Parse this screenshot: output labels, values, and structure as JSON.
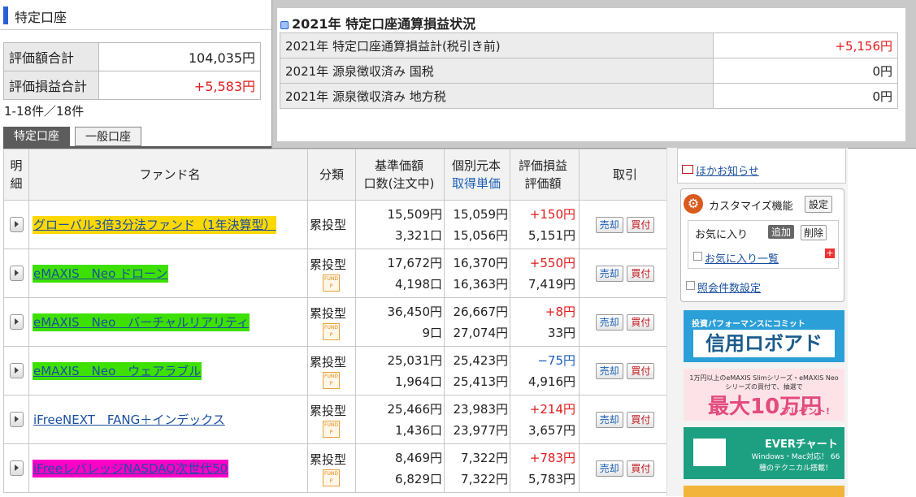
{
  "header": {
    "title": "特定口座"
  },
  "summary": [
    {
      "label": "評価額合計",
      "value": "104,035円",
      "color": "#222222"
    },
    {
      "label": "評価損益合計",
      "value": "+5,583円",
      "color": "#e01b1b"
    }
  ],
  "count_text": "1-18件／18件",
  "tabs": {
    "tokutei": "特定口座",
    "ippan": "一般口座"
  },
  "columns": {
    "detail": [
      "明",
      "細"
    ],
    "fund_name": "ファンド名",
    "category": "分類",
    "price": [
      "基準価額",
      "口数(注文中)"
    ],
    "cost": [
      "個別元本",
      "取得単価"
    ],
    "pl": [
      "評価損益",
      "評価額"
    ],
    "trade": "取引"
  },
  "funds": [
    {
      "name": "グローバル3倍3分法ファンド（1年決算型）",
      "highlight": "yellow",
      "category": "累投型",
      "fund_icon": false,
      "price": "15,509円",
      "units": "3,321口",
      "cost": "15,059円",
      "unit_cost": "15,056円",
      "pl": "+150円",
      "value": "5,151円"
    },
    {
      "name": "eMAXIS　Neo ドローン",
      "highlight": "green",
      "category": "累投型",
      "fund_icon": true,
      "price": "17,672円",
      "units": "4,198口",
      "cost": "16,370円",
      "unit_cost": "16,363円",
      "pl": "+550円",
      "value": "7,419円"
    },
    {
      "name": "eMAXIS　Neo　バーチャルリアリティ",
      "highlight": "green",
      "category": "累投型",
      "fund_icon": true,
      "price": "36,450円",
      "units": "9口",
      "cost": "26,667円",
      "unit_cost": "27,074円",
      "pl": "+8円",
      "value": "33円"
    },
    {
      "name": "eMAXIS　Neo　ウェアラブル",
      "highlight": "green",
      "category": "累投型",
      "fund_icon": true,
      "price": "25,031円",
      "units": "1,964口",
      "cost": "25,423円",
      "unit_cost": "25,413円",
      "pl": "−75円",
      "value": "4,916円"
    },
    {
      "name": "iFreeNEXT　FANG＋インデックス",
      "highlight": "none",
      "category": "累投型",
      "fund_icon": true,
      "price": "25,466円",
      "units": "1,436口",
      "cost": "23,983円",
      "unit_cost": "23,977円",
      "pl": "+214円",
      "value": "3,657円"
    },
    {
      "name": "iFreeレバレッジNASDAQ次世代50",
      "highlight": "pink",
      "category": "累投型",
      "fund_icon": true,
      "price": "8,469円",
      "units": "6,829口",
      "cost": "7,322円",
      "unit_cost": "7,322円",
      "pl": "+783円",
      "value": "5,783円"
    }
  ],
  "fund_icon_text": "FUND P",
  "trade_buttons": {
    "sell": "売却",
    "buy": "買付"
  },
  "popup": {
    "title": "2021年 特定口座通算損益状況",
    "rows": [
      {
        "label": "2021年 特定口座通算損益計(税引き前)",
        "value": "+5,156円",
        "color": "#e01b1b"
      },
      {
        "label": "2021年 源泉徴収済み 国税",
        "value": "0円",
        "color": "#222222"
      },
      {
        "label": "2021年 源泉徴収済み 地方税",
        "value": "0円",
        "color": "#222222"
      }
    ]
  },
  "sidebar": {
    "news_link": "ほかお知らせ",
    "customize_title": "カスタマイズ機能",
    "customize_settings": "設定",
    "favorites_label": "お気に入り",
    "favorites_add": "追加",
    "favorites_delete": "削除",
    "favorites_list": "お気に入り一覧",
    "view_count_settings": "照会件数設定",
    "ads": [
      {
        "small": "投資パフォーマンスにコミット",
        "big": "信用ロボアド"
      },
      {
        "small": "1万円以上のeMAXIS Slimシリーズ・eMAXIS Neoシリーズの買付で、抽選で",
        "big": "最大10万円",
        "sub": "プレゼント!"
      },
      {
        "big": "EVERチャート",
        "small": "Windows・Mac対応！ 66種のテクニカル搭載！"
      }
    ]
  }
}
